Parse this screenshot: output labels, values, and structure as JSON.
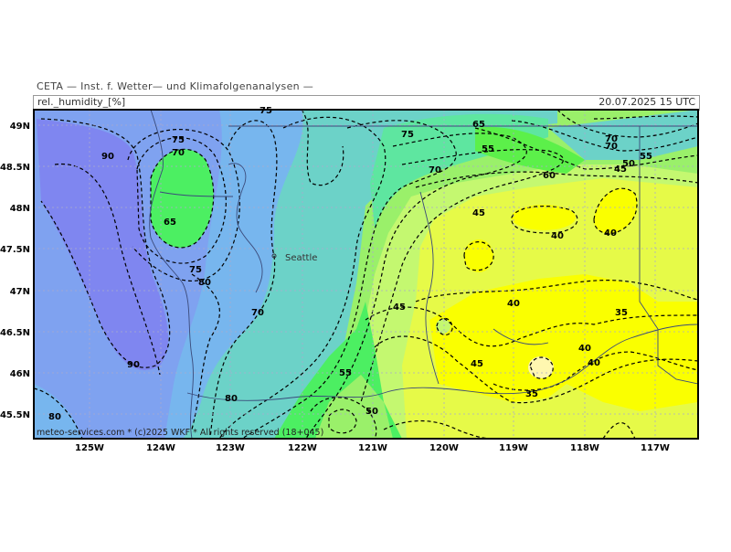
{
  "header": {
    "title": "CETA — Inst. f. Wetter— und Klimafolgenanalysen —",
    "parameter": "rel._humidity_[%]",
    "valid_time": "20.07.2025  15 UTC"
  },
  "footer": {
    "credit": "meteo-services.com * (c)2025 WKF * All rights reserved (18+045)"
  },
  "place_labels": [
    {
      "name": "Seattle"
    }
  ],
  "axes": {
    "lat_labels": [
      "49N",
      "48.5N",
      "48N",
      "47.5N",
      "47N",
      "46.5N",
      "46N",
      "45.5N"
    ],
    "lon_labels": [
      "125W",
      "124W",
      "123W",
      "122W",
      "121W",
      "120W",
      "119W",
      "118W",
      "117W"
    ]
  },
  "contour_labels": [
    "90",
    "75",
    "70",
    "65",
    "75",
    "80",
    "90",
    "80",
    "75",
    "70",
    "80",
    "75",
    "70",
    "65",
    "55",
    "60",
    "45",
    "50",
    "55",
    "70",
    "40",
    "40",
    "45",
    "40",
    "35",
    "40",
    "45",
    "40",
    "35",
    "45",
    "55",
    "50",
    "70"
  ],
  "colors": {
    "h90": "#7f86f0",
    "h85": "#7fa2f0",
    "h80": "#77b6ee",
    "h75": "#6cd2c8",
    "h70": "#5ee6a0",
    "h65": "#4cef62",
    "h60": "#5cf04a",
    "h55": "#9af06a",
    "h45": "#c4f870",
    "h40": "#e6fa48",
    "h35": "#faff00",
    "contour": "#000000",
    "border": "#000000"
  }
}
